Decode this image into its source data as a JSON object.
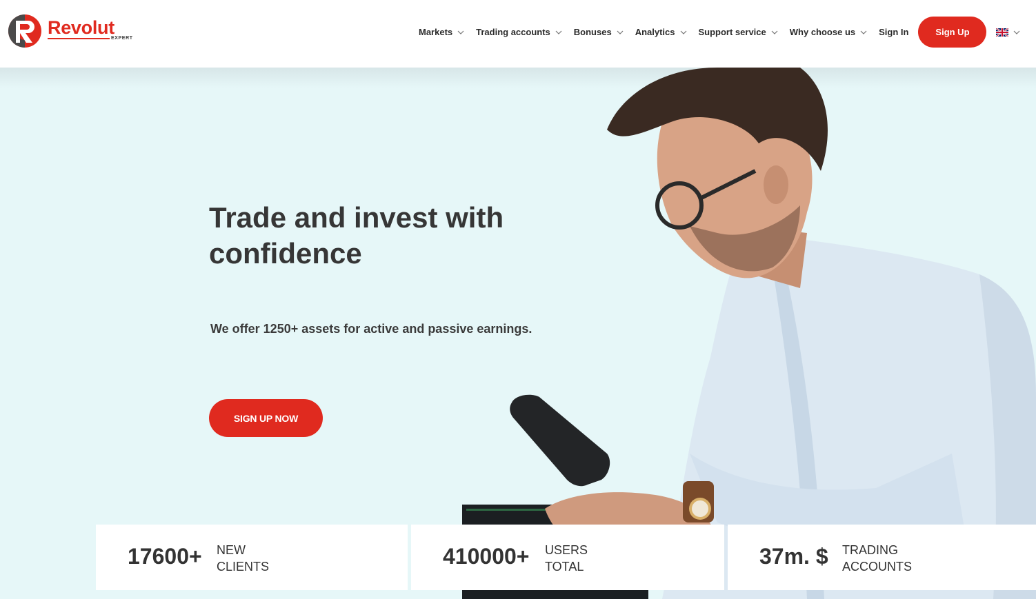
{
  "brand": {
    "name": "Revolut",
    "sub": "EXPERT",
    "accent": "#e02a1f"
  },
  "nav": {
    "items": [
      {
        "label": "Markets"
      },
      {
        "label": "Trading accounts"
      },
      {
        "label": "Bonuses"
      },
      {
        "label": "Analytics"
      },
      {
        "label": "Support service"
      },
      {
        "label": "Why choose us"
      }
    ],
    "sign_in": "Sign In",
    "sign_up": "Sign Up",
    "language_icon": "uk-flag-icon"
  },
  "hero": {
    "title": "Trade and invest with confidence",
    "subtitle": "We offer 1250+ assets for active and passive earnings.",
    "cta": "SIGN UP NOW",
    "background": "#e6f7f8"
  },
  "stats": [
    {
      "value": "17600+",
      "label_1": "NEW",
      "label_2": "CLIENTS"
    },
    {
      "value": "410000+",
      "label_1": "USERS",
      "label_2": "TOTAL"
    },
    {
      "value": "37m. $",
      "label_1": "TRADING",
      "label_2": "ACCOUNTS"
    }
  ]
}
